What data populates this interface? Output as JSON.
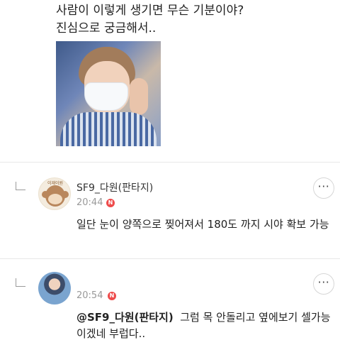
{
  "post": {
    "line1": "사람이 이렇게 생기면 무슨 기분이야?",
    "line2": "진심으로 궁금해서.."
  },
  "comments": [
    {
      "username": "SF9_다원(판타지)",
      "time": "20:44",
      "new_badge": "N",
      "avatar_label": "이재이원",
      "text": "일단 눈이 양쪽으로 찢어져서 180도 까지 시야 확보 가능",
      "more_label": "···"
    },
    {
      "time": "20:54",
      "new_badge": "N",
      "mention": "@SF9_다원(판타지)",
      "text": "그럼 목 안돌리고 옆에보기 셀가능이겠네 부럽다..",
      "more_label": "···"
    }
  ],
  "colors": {
    "badge": "#ee4b4b",
    "divider": "#e8e8e8"
  },
  "icons": {
    "reply": "reply-arrow-icon",
    "more": "more-dots-icon",
    "new": "new-badge-icon"
  }
}
